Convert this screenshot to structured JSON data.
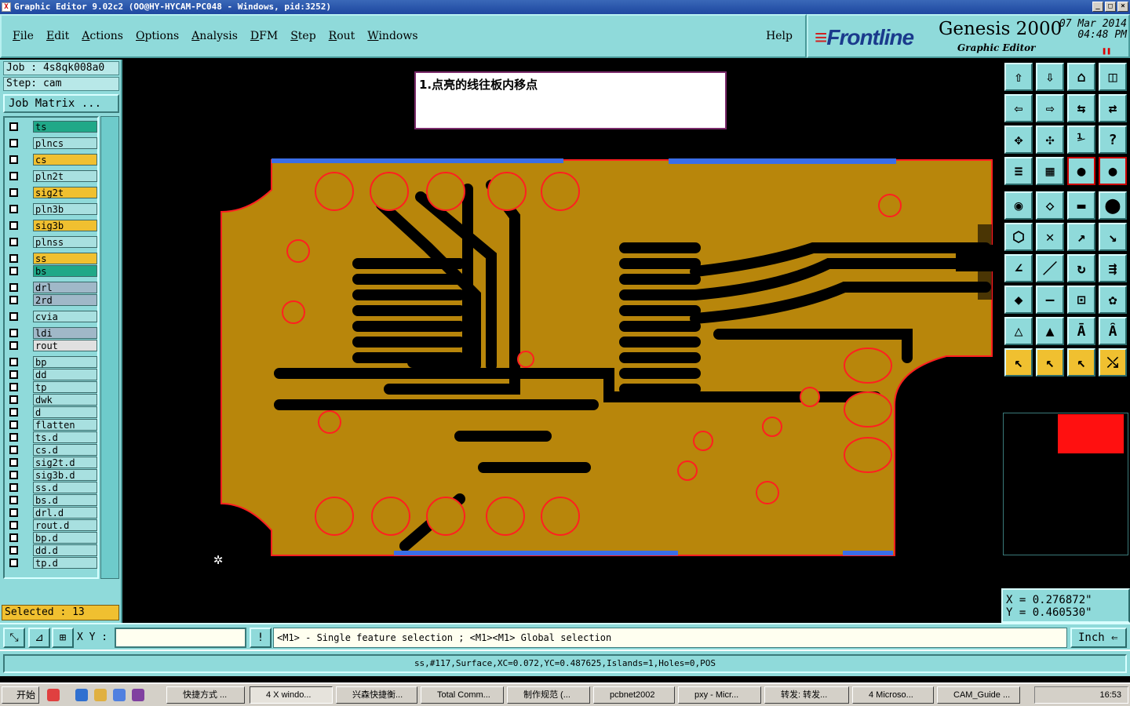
{
  "window": {
    "title": "Graphic Editor 9.02c2  (OO@HY-HYCAM-PC048 - Windows, pid:3252)"
  },
  "menu": {
    "items": [
      "File",
      "Edit",
      "Actions",
      "Options",
      "Analysis",
      "DFM",
      "Step",
      "Rout",
      "Windows"
    ],
    "help": "Help"
  },
  "brand": {
    "logo_prefix": "≡",
    "logo": "Frontline",
    "product": "Genesis 2000",
    "subtitle": "Graphic Editor",
    "date": "07 Mar 2014",
    "time": "04:48 PM"
  },
  "job": {
    "job_label": "Job  : 4s8qk008a0",
    "step_label": "Step: cam",
    "matrix_button": "Job Matrix ..."
  },
  "layers": [
    {
      "name": "ts",
      "color": "#20a888"
    },
    {
      "name": "plncs",
      "color": "#a8e0e0"
    },
    {
      "name": "cs",
      "color": "#f0c030"
    },
    {
      "name": "pln2t",
      "color": "#a8e0e0"
    },
    {
      "name": "sig2t",
      "color": "#f0c030"
    },
    {
      "name": "pln3b",
      "color": "#a8e0e0"
    },
    {
      "name": "sig3b",
      "color": "#f0c030"
    },
    {
      "name": "plnss",
      "color": "#a8e0e0"
    },
    {
      "name": "ss",
      "color": "#f0c030"
    },
    {
      "name": "bs",
      "color": "#20a888"
    },
    {
      "name": "drl",
      "color": "#a0b8c8"
    },
    {
      "name": "2rd",
      "color": "#a0b8c8"
    },
    {
      "name": "cvia",
      "color": "#a8e0e0"
    },
    {
      "name": "ldi",
      "color": "#a0b8c8"
    },
    {
      "name": "rout",
      "color": "#e0e0e0"
    },
    {
      "name": "bp",
      "color": "#a8e0e0"
    },
    {
      "name": "dd",
      "color": "#a8e0e0"
    },
    {
      "name": "tp",
      "color": "#a8e0e0"
    },
    {
      "name": "dwk",
      "color": "#a8e0e0"
    },
    {
      "name": "d",
      "color": "#a8e0e0"
    },
    {
      "name": "flatten",
      "color": "#a8e0e0"
    },
    {
      "name": "ts.d",
      "color": "#a8e0e0"
    },
    {
      "name": "cs.d",
      "color": "#a8e0e0"
    },
    {
      "name": "sig2t.d",
      "color": "#a8e0e0"
    },
    {
      "name": "sig3b.d",
      "color": "#a8e0e0"
    },
    {
      "name": "ss.d",
      "color": "#a8e0e0"
    },
    {
      "name": "bs.d",
      "color": "#a8e0e0"
    },
    {
      "name": "drl.d",
      "color": "#a8e0e0"
    },
    {
      "name": "rout.d",
      "color": "#a8e0e0"
    },
    {
      "name": "bp.d",
      "color": "#a8e0e0"
    },
    {
      "name": "dd.d",
      "color": "#a8e0e0"
    },
    {
      "name": "tp.d",
      "color": "#a8e0e0"
    }
  ],
  "selected": "Selected : 13",
  "note": "1.点亮的线往板内移点",
  "coords": {
    "x": "X  = 0.276872\"",
    "y": "Y  = 0.460530\""
  },
  "cmd": {
    "xy_label": "X Y :",
    "xy_value": "",
    "hint": "<M1> - Single feature selection ; <M1><M1> Global selection",
    "units": "Inch"
  },
  "status": "ss,#117,Surface,XC=0.072,YC=0.487625,Islands=1,Holes=0,POS",
  "taskbar": {
    "start": "开始",
    "tasks": [
      "快捷方式 ...",
      "4 X windo...",
      "兴森快捷衡...",
      "Total Comm...",
      "制作规范 (...",
      "pcbnet2002",
      "pxy - Micr...",
      "转发: 转发...",
      "4 Microso...",
      "CAM_Guide ..."
    ],
    "clock": "16:53"
  },
  "colors": {
    "panel": "#8fdada",
    "copper": "#b8860b",
    "edge": "#ff2020",
    "highlight": "#3a6ee8"
  }
}
